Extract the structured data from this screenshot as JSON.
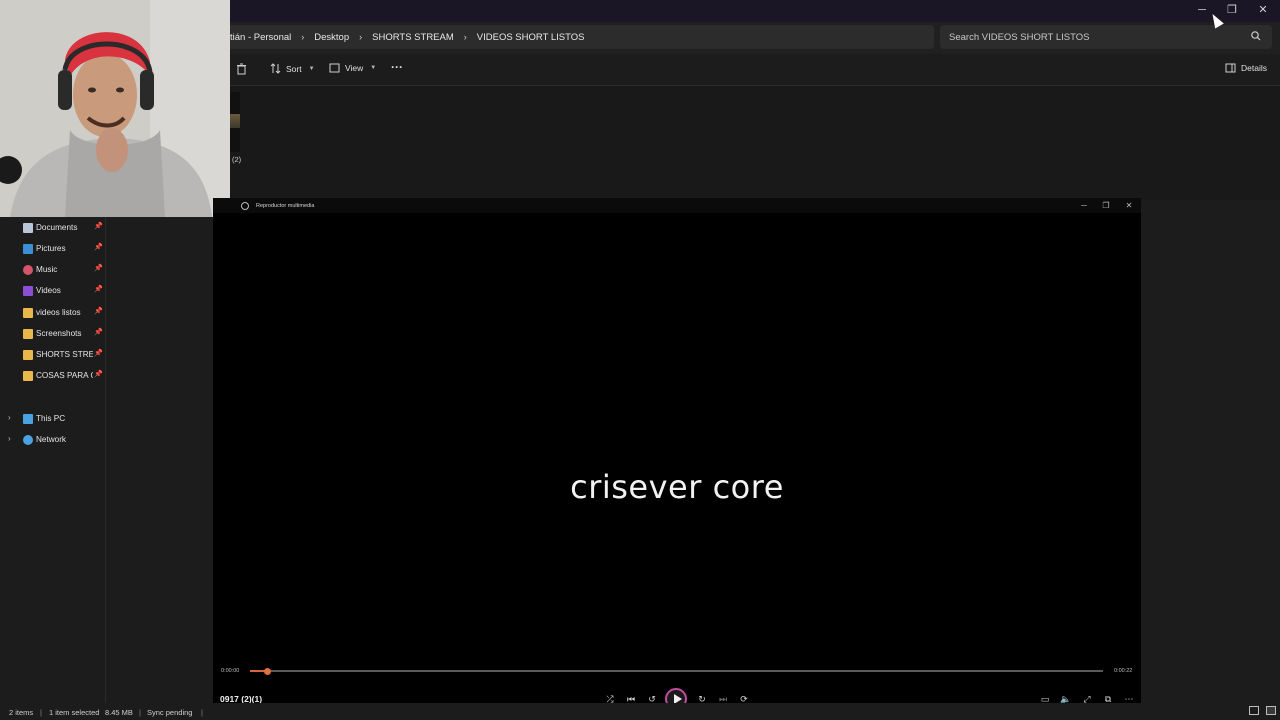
{
  "explorer": {
    "breadcrumb": [
      "tián - Personal",
      "Desktop",
      "SHORTS STREAM",
      "VIDEOS SHORT LISTOS"
    ],
    "search_placeholder": "Search VIDEOS SHORT LISTOS",
    "toolbar": {
      "sort_label": "Sort",
      "view_label": "View",
      "more_label": "···",
      "details_label": "Details"
    },
    "file_thumb_label": "(2)"
  },
  "sidebar": {
    "pinned": [
      {
        "label": "Documents",
        "icon": "document-icon",
        "color": "#b9c6d8"
      },
      {
        "label": "Pictures",
        "icon": "pictures-icon",
        "color": "#3d8fd4"
      },
      {
        "label": "Music",
        "icon": "music-icon",
        "color": "#d4546a"
      },
      {
        "label": "Videos",
        "icon": "videos-icon",
        "color": "#8a4fd4"
      },
      {
        "label": "videos listos",
        "icon": "folder-icon",
        "color": "#e8b94a"
      },
      {
        "label": "Screenshots",
        "icon": "folder-icon",
        "color": "#e8b94a"
      },
      {
        "label": "SHORTS STREAM",
        "icon": "folder-icon",
        "color": "#e8b94a"
      },
      {
        "label": "COSAS PARA CA",
        "icon": "folder-icon",
        "color": "#e8b94a"
      }
    ],
    "locations": [
      {
        "label": "This PC",
        "icon": "computer-icon",
        "color": "#4aa3e0"
      },
      {
        "label": "Network",
        "icon": "network-icon",
        "color": "#4aa3e0"
      }
    ]
  },
  "statusbar": {
    "items_count": "2 items",
    "selected": "1 item selected",
    "size": "8.45 MB",
    "sync": "Sync pending"
  },
  "player": {
    "title": "Reproductor multimedia",
    "caption": "crisever core",
    "time_current": "0:00:00",
    "time_total": "0:00:22",
    "progress": 0.02,
    "file_name": "0917 (2)(1)",
    "accent": "#c64aa0"
  }
}
